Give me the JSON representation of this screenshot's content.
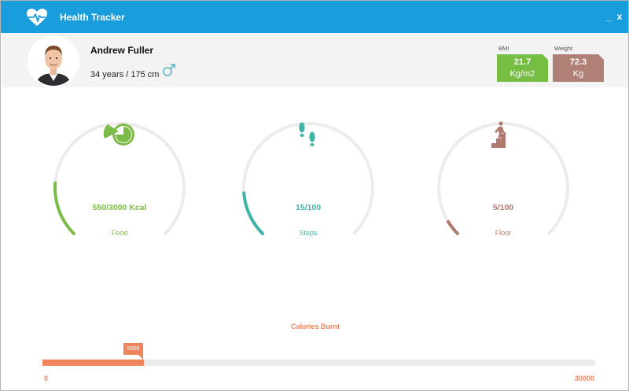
{
  "app": {
    "title": "Health Tracker",
    "accent_color": "#1a9ddc",
    "window_controls": {
      "minimize": "_",
      "close": "x"
    }
  },
  "profile": {
    "name": "Andrew Fuller",
    "details": "34 years / 175 cm",
    "gender_icon": "male-icon",
    "bmi": {
      "label": "BMI",
      "value": "21.7",
      "unit": "Kg/m2",
      "color": "#76bd44"
    },
    "weight": {
      "label": "Weight",
      "value": "72.3",
      "unit": "Kg",
      "color": "#b08077"
    }
  },
  "gauges": [
    {
      "id": "food",
      "value_text": "550/3000 Kcal",
      "label": "Food",
      "current": 550,
      "max": 3000,
      "color": "#7dbb47",
      "icon": "pie-chart-icon"
    },
    {
      "id": "steps",
      "value_text": "15/100",
      "label": "Steps",
      "current": 15,
      "max": 100,
      "color": "#3fb4a6",
      "icon": "footsteps-icon"
    },
    {
      "id": "floor",
      "value_text": "5/100",
      "label": "Floor",
      "current": 5,
      "max": 100,
      "color": "#b07a70",
      "icon": "stairs-climber-icon"
    }
  ],
  "calories": {
    "title": "Calories Burnt",
    "current": 5500,
    "current_label": "5500",
    "min": 0,
    "max": 30000,
    "min_label": "0",
    "max_label": "30000",
    "color": "#f0855c"
  }
}
